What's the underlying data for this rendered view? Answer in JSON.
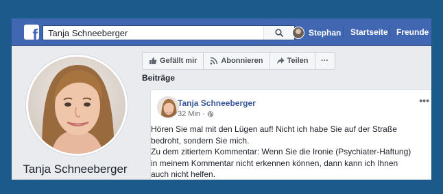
{
  "topbar": {
    "logo_letter": "f",
    "search_value": "Tanja Schneeberger",
    "user_name": "Stephan",
    "nav": [
      "Startseite",
      "Freunde f"
    ]
  },
  "profile": {
    "name": "Tanja Schneeberger"
  },
  "actions": [
    {
      "label": "Gefällt mir",
      "icon": "thumbs-up-icon"
    },
    {
      "label": "Abonnieren",
      "icon": "rss-icon"
    },
    {
      "label": "Teilen",
      "icon": "share-arrow-icon"
    },
    {
      "label": "···",
      "icon": "more-icon"
    }
  ],
  "section_title": "Beiträge",
  "post": {
    "author": "Tanja Schneeberger",
    "time": "32 Min",
    "separator": "·",
    "audience_icon": "globe-icon",
    "more": "•••",
    "lines": [
      "Hören Sie mal mit den Lügen auf! Nicht ich habe Sie auf der Straße",
      "bedroht, sondern Sie mich.",
      "Zu dem zitiertem Kommentar: Wenn Sie die Ironie (Psychiater-Haftung)",
      "in meinem Kommentar nicht erkennen können, dann kann ich Ihnen",
      "auch nicht helfen."
    ]
  },
  "colors": {
    "background": "#1d5a8c",
    "topbar": "#4267b2",
    "link": "#385898",
    "page": "#e9ebee"
  }
}
